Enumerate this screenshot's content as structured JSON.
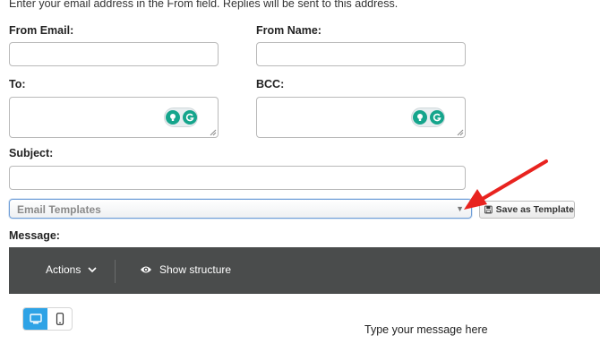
{
  "intro_text": "Enter your email address in the From field. Replies will be sent to this address.",
  "form": {
    "from_email_label": "From Email:",
    "from_name_label": "From Name:",
    "to_label": "To:",
    "bcc_label": "BCC:",
    "subject_label": "Subject:",
    "message_label": "Message:"
  },
  "templates": {
    "selected": "Email Templates",
    "save_label": "Save as Template"
  },
  "editor": {
    "actions_label": "Actions",
    "structure_label": "Show structure",
    "placeholder": "Type your message here"
  },
  "colors": {
    "toolbar_bg": "#4a4c4c",
    "grammarly_green": "#15a58c",
    "device_active": "#2ea3e6",
    "annotation_arrow": "#e8231f"
  },
  "icons": [
    "grammarly-suggest-icon",
    "grammarly-g-icon",
    "dropdown-arrow-icon",
    "floppy-disk-icon",
    "chevron-down-icon",
    "eye-icon",
    "desktop-icon",
    "mobile-icon",
    "red-arrow-annotation"
  ]
}
